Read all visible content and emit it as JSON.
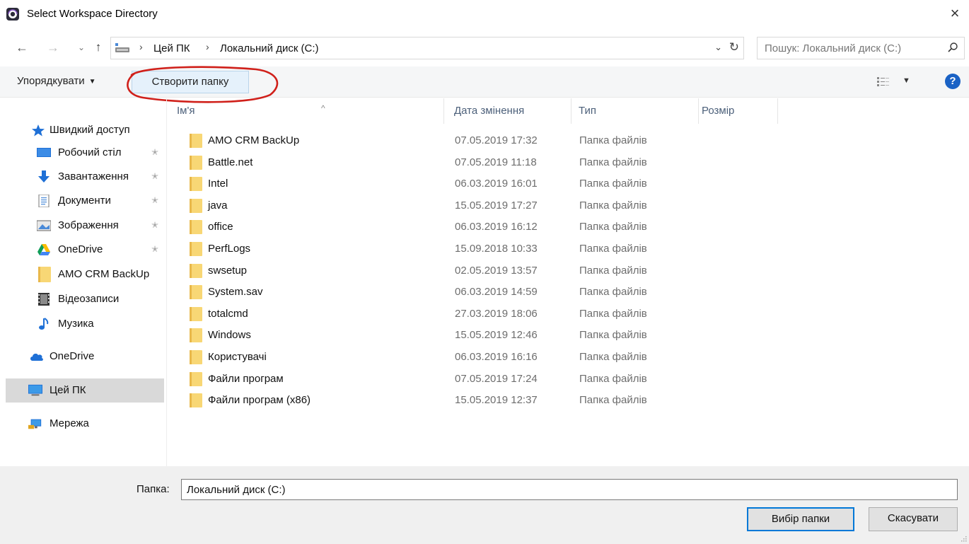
{
  "window": {
    "title": "Select Workspace Directory",
    "close_glyph": "×",
    "icon": "app-icon"
  },
  "nav": {
    "back_glyph": "←",
    "forward_glyph": "→",
    "recent_glyph": "⌄",
    "up_glyph": "↑",
    "breadcrumb": [
      "Цей ПК",
      "Локальний диск (C:)"
    ],
    "separator": "›",
    "refresh_glyph": "↻",
    "dropdown_glyph": "⌄"
  },
  "search": {
    "placeholder": "Пошук: Локальний диск (C:)",
    "icon_glyph": "⌕"
  },
  "commandbar": {
    "organize_label": "Упорядкувати",
    "organize_caret": "▼",
    "new_folder_label": "Створити папку",
    "view_caret": "▼",
    "help_label": "?",
    "annotation_color": "#d0201a"
  },
  "sidebar": {
    "items": [
      {
        "label": "Швидкий доступ",
        "icon": "star-icon",
        "pinned": false
      },
      {
        "label": "Робочий стіл",
        "icon": "desktop-icon",
        "pinned": true
      },
      {
        "label": "Завантаження",
        "icon": "download-icon",
        "pinned": true
      },
      {
        "label": "Документи",
        "icon": "documents-icon",
        "pinned": true
      },
      {
        "label": "Зображення",
        "icon": "pictures-icon",
        "pinned": true
      },
      {
        "label": "OneDrive",
        "icon": "google-drive-icon",
        "pinned": true
      },
      {
        "label": "AMO CRM BackUp",
        "icon": "folder-icon",
        "pinned": false
      },
      {
        "label": "Відеозаписи",
        "icon": "videos-icon",
        "pinned": false
      },
      {
        "label": "Музика",
        "icon": "music-icon",
        "pinned": false
      },
      {
        "label": "OneDrive",
        "icon": "cloud-icon",
        "pinned": false
      },
      {
        "label": "Цей ПК",
        "icon": "computer-icon",
        "pinned": false,
        "selected": true
      },
      {
        "label": "Мережа",
        "icon": "network-icon",
        "pinned": false
      }
    ],
    "pin_glyph": "✭"
  },
  "filelist": {
    "columns": [
      "Ім'я",
      "Дата змінення",
      "Тип",
      "Розмір"
    ],
    "sort_glyph": "^",
    "rows": [
      {
        "name": "AMO CRM BackUp",
        "date": "07.05.2019 17:32",
        "type": "Папка файлів"
      },
      {
        "name": "Battle.net",
        "date": "07.05.2019 11:18",
        "type": "Папка файлів"
      },
      {
        "name": "Intel",
        "date": "06.03.2019 16:01",
        "type": "Папка файлів"
      },
      {
        "name": "java",
        "date": "15.05.2019 17:27",
        "type": "Папка файлів"
      },
      {
        "name": "office",
        "date": "06.03.2019 16:12",
        "type": "Папка файлів"
      },
      {
        "name": "PerfLogs",
        "date": "15.09.2018 10:33",
        "type": "Папка файлів"
      },
      {
        "name": "swsetup",
        "date": "02.05.2019 13:57",
        "type": "Папка файлів"
      },
      {
        "name": "System.sav",
        "date": "06.03.2019 14:59",
        "type": "Папка файлів"
      },
      {
        "name": "totalcmd",
        "date": "27.03.2019 18:06",
        "type": "Папка файлів"
      },
      {
        "name": "Windows",
        "date": "15.05.2019 12:46",
        "type": "Папка файлів"
      },
      {
        "name": "Користувачі",
        "date": "06.03.2019 16:16",
        "type": "Папка файлів"
      },
      {
        "name": "Файли програм",
        "date": "07.05.2019 17:24",
        "type": "Папка файлів"
      },
      {
        "name": "Файли програм (x86)",
        "date": "15.05.2019 12:37",
        "type": "Папка файлів"
      }
    ]
  },
  "footer": {
    "folder_label": "Папка:",
    "folder_value": "Локальний диск (C:)",
    "select_button": "Вибір папки",
    "cancel_button": "Скасувати"
  },
  "colors": {
    "accent": "#0078d7",
    "folder": "#f8d775",
    "header_text": "#4c607a",
    "selected_bg": "#d9d9d9"
  }
}
